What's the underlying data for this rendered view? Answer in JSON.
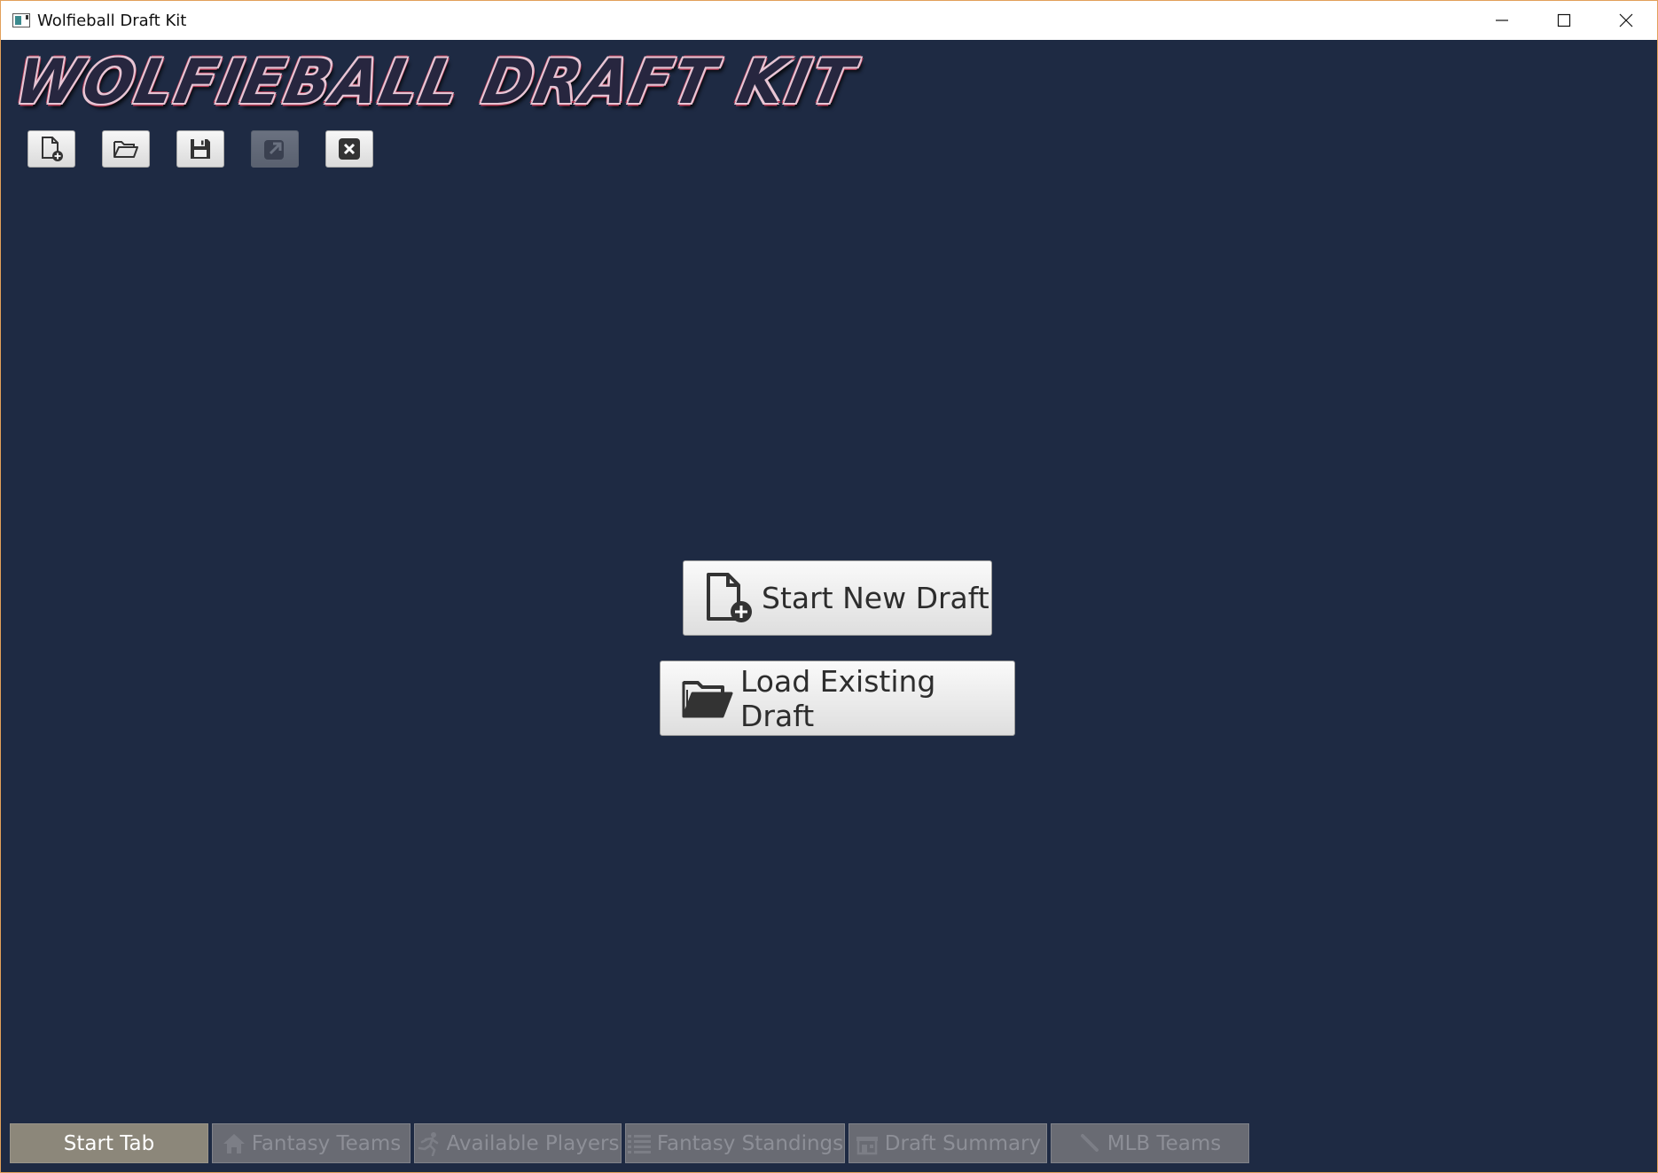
{
  "window": {
    "title": "Wolfieball Draft Kit",
    "minimize_icon": "minimize-icon",
    "maximize_icon": "maximize-icon",
    "close_icon": "close-icon"
  },
  "logo": {
    "text": "WOLFIEBALL DRAFT KIT"
  },
  "toolbar": {
    "buttons": [
      {
        "icon": "new-document-icon",
        "enabled": true
      },
      {
        "icon": "open-folder-icon",
        "enabled": true
      },
      {
        "icon": "save-icon",
        "enabled": true
      },
      {
        "icon": "export-icon",
        "enabled": false
      },
      {
        "icon": "exit-icon",
        "enabled": true
      }
    ]
  },
  "main": {
    "start_new_draft": "Start New Draft",
    "load_existing_draft": "Load Existing Draft"
  },
  "tabs": [
    {
      "label": "Start Tab",
      "icon": "",
      "active": true
    },
    {
      "label": "Fantasy Teams",
      "icon": "home-icon",
      "active": false
    },
    {
      "label": "Available Players",
      "icon": "running-man-icon",
      "active": false
    },
    {
      "label": "Fantasy Standings",
      "icon": "list-icon",
      "active": false
    },
    {
      "label": "Draft Summary",
      "icon": "store-icon",
      "active": false
    },
    {
      "label": "MLB Teams",
      "icon": "bat-icon",
      "active": false
    }
  ],
  "colors": {
    "background": "#1e2a43",
    "tab_inactive": "#696b73",
    "tab_active": "#8c877a"
  }
}
